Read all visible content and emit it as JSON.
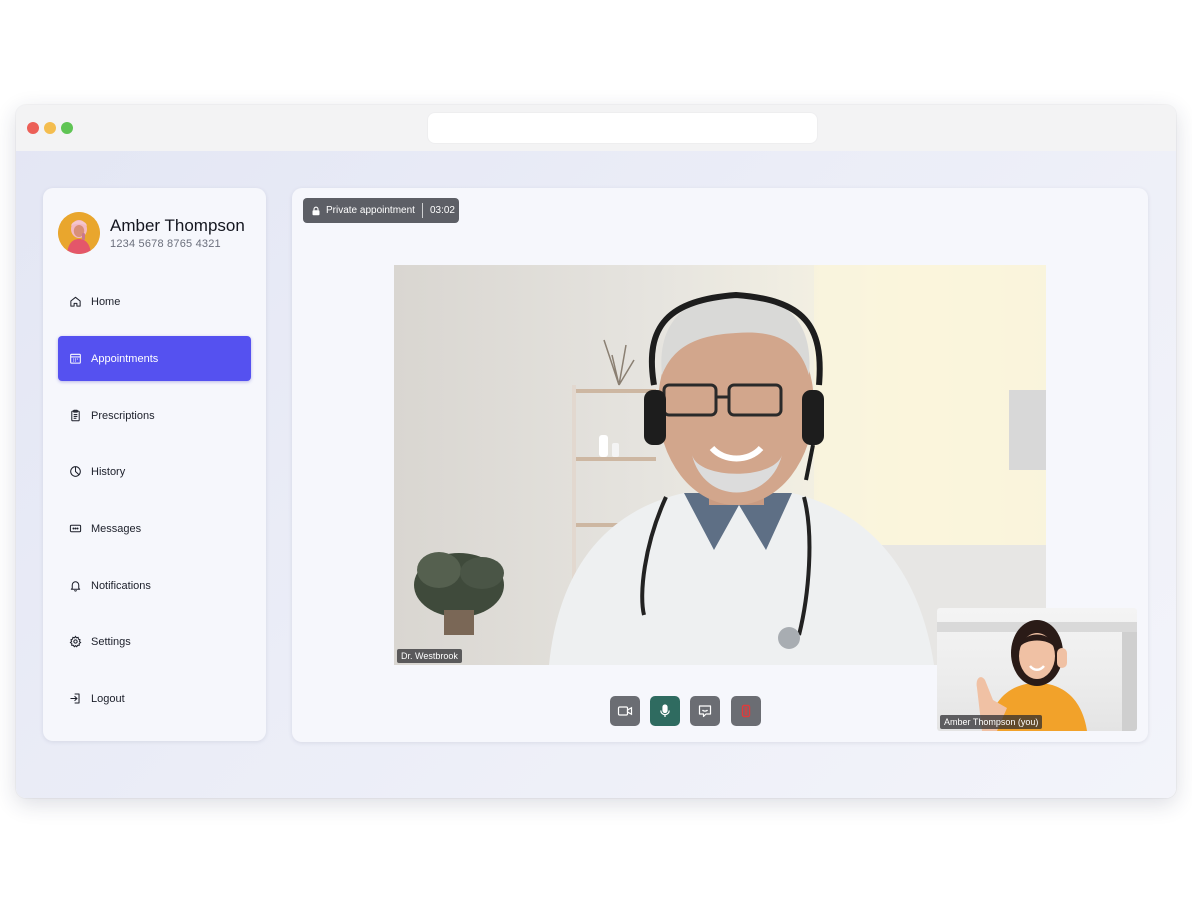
{
  "user": {
    "name": "Amber Thompson",
    "id": "1234 5678 8765 4321"
  },
  "nav": [
    {
      "label": "Home",
      "icon": "home-icon",
      "active": false
    },
    {
      "label": "Appointments",
      "icon": "calendar-icon",
      "active": true
    },
    {
      "label": "Prescriptions",
      "icon": "clipboard-icon",
      "active": false
    },
    {
      "label": "History",
      "icon": "pie-chart-icon",
      "active": false
    },
    {
      "label": "Messages",
      "icon": "message-icon",
      "active": false
    },
    {
      "label": "Notifications",
      "icon": "bell-icon",
      "active": false
    },
    {
      "label": "Settings",
      "icon": "gear-icon",
      "active": false
    },
    {
      "label": "Logout",
      "icon": "logout-icon",
      "active": false
    }
  ],
  "call": {
    "privacy_label": "Private appointment",
    "timer": "03:02",
    "remote_name": "Dr. Westbrook",
    "self_name": "Amber Thompson (you)"
  },
  "controls": [
    {
      "name": "camera",
      "icon": "video-camera-icon",
      "color": "#6b6d73"
    },
    {
      "name": "microphone",
      "icon": "microphone-icon",
      "color": "#2f6b60"
    },
    {
      "name": "chat",
      "icon": "chat-icon",
      "color": "#6b6d73"
    },
    {
      "name": "end-call",
      "icon": "end-call-icon",
      "color": "#6b6d73"
    }
  ],
  "colors": {
    "accent": "#5551f0",
    "end_call_red": "#e23a3a"
  }
}
